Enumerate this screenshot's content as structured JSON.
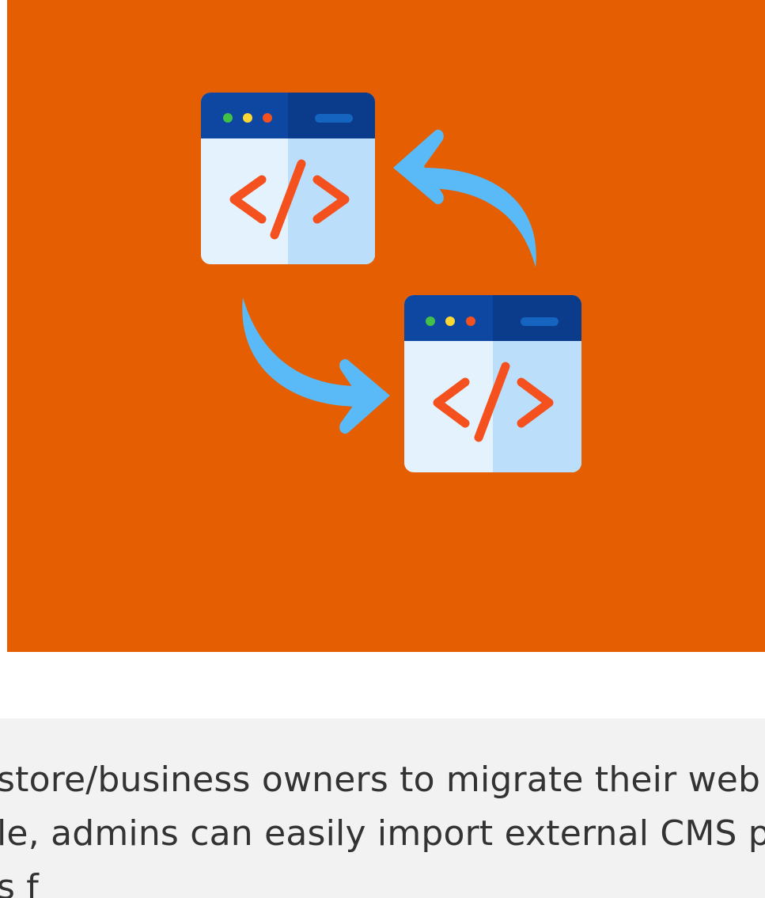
{
  "hero": {
    "background_color": "#e55e02",
    "icon": "code-migration-icon",
    "colors": {
      "window_header_dark": "#0b3c8c",
      "window_header": "#0d47a1",
      "window_body_light": "#e3f2fd",
      "window_body_shade": "#bbdefb",
      "code_glyph": "#f4511e",
      "arrow": "#5ab9f7",
      "dot_green": "#43c047",
      "dot_yellow": "#fdd835",
      "dot_red": "#f4511e"
    }
  },
  "description": {
    "lines": [
      "store/business owners to migrate their web",
      "le, admins can easily import external CMS p",
      "s    f    "
    ]
  }
}
